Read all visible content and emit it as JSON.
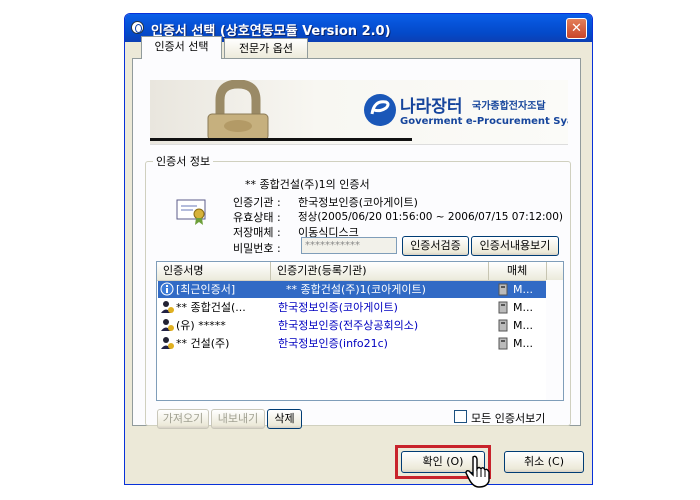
{
  "window": {
    "title": "인증서 선택 (상호연동모듈 Version 2.0)",
    "close_glyph": "✕"
  },
  "tabs": [
    {
      "label": "인증서 선택",
      "active": true
    },
    {
      "label": "전문가 옵션",
      "active": false
    }
  ],
  "banner": {
    "brand_main": "나라장터",
    "brand_sub": "국가종합전자조달",
    "brand_en": "Goverment e-Procurement Syatem"
  },
  "cert_info": {
    "group_label": "인증서 정보",
    "owner_line": "** 종합건설(주)1의 인증서",
    "issuer_label": "인증기관 :",
    "issuer_value": "한국정보인증(코아게이트)",
    "validity_label": "유효상태 :",
    "validity_value": "정상(2005/06/20 01:56:00 ~ 2006/07/15 07:12:00)",
    "storage_label": "저장매체 :",
    "storage_value": "이동식디스크",
    "password_label": "비밀번호 :",
    "password_value": "***********",
    "verify_button": "인증서검증",
    "view_button": "인증서내용보기"
  },
  "cert_list": {
    "columns": [
      "인증서명",
      "인증기관(등록기관)",
      "매체"
    ],
    "rows": [
      {
        "name": "[최근인증서]",
        "issuer": "** 종합건설(주)1(코아게이트)",
        "media": "M...",
        "selected": true,
        "icon": "info-icon"
      },
      {
        "name": "** 종합건설(...",
        "issuer": "한국정보인증(코아게이트)",
        "media": "M...",
        "selected": false,
        "icon": "user-cert-icon"
      },
      {
        "name": "(유) *****",
        "issuer": "한국정보인증(전주상공회의소)",
        "media": "M...",
        "selected": false,
        "icon": "user-cert-icon"
      },
      {
        "name": "** 건설(주)",
        "issuer": "한국정보인증(info21c)",
        "media": "M...",
        "selected": false,
        "icon": "user-cert-icon"
      }
    ]
  },
  "list_actions": {
    "import_button": "가져오기",
    "export_button": "내보내기",
    "delete_button": "삭제",
    "show_all_label": "모든 인증서보기"
  },
  "footer": {
    "ok_button": "확인 (O)",
    "cancel_button": "취소 (C)"
  },
  "colors": {
    "titlebar": "#0651d6",
    "selection": "#316ac5",
    "highlight_frame": "#c8232b",
    "link_text": "#0000c0"
  }
}
